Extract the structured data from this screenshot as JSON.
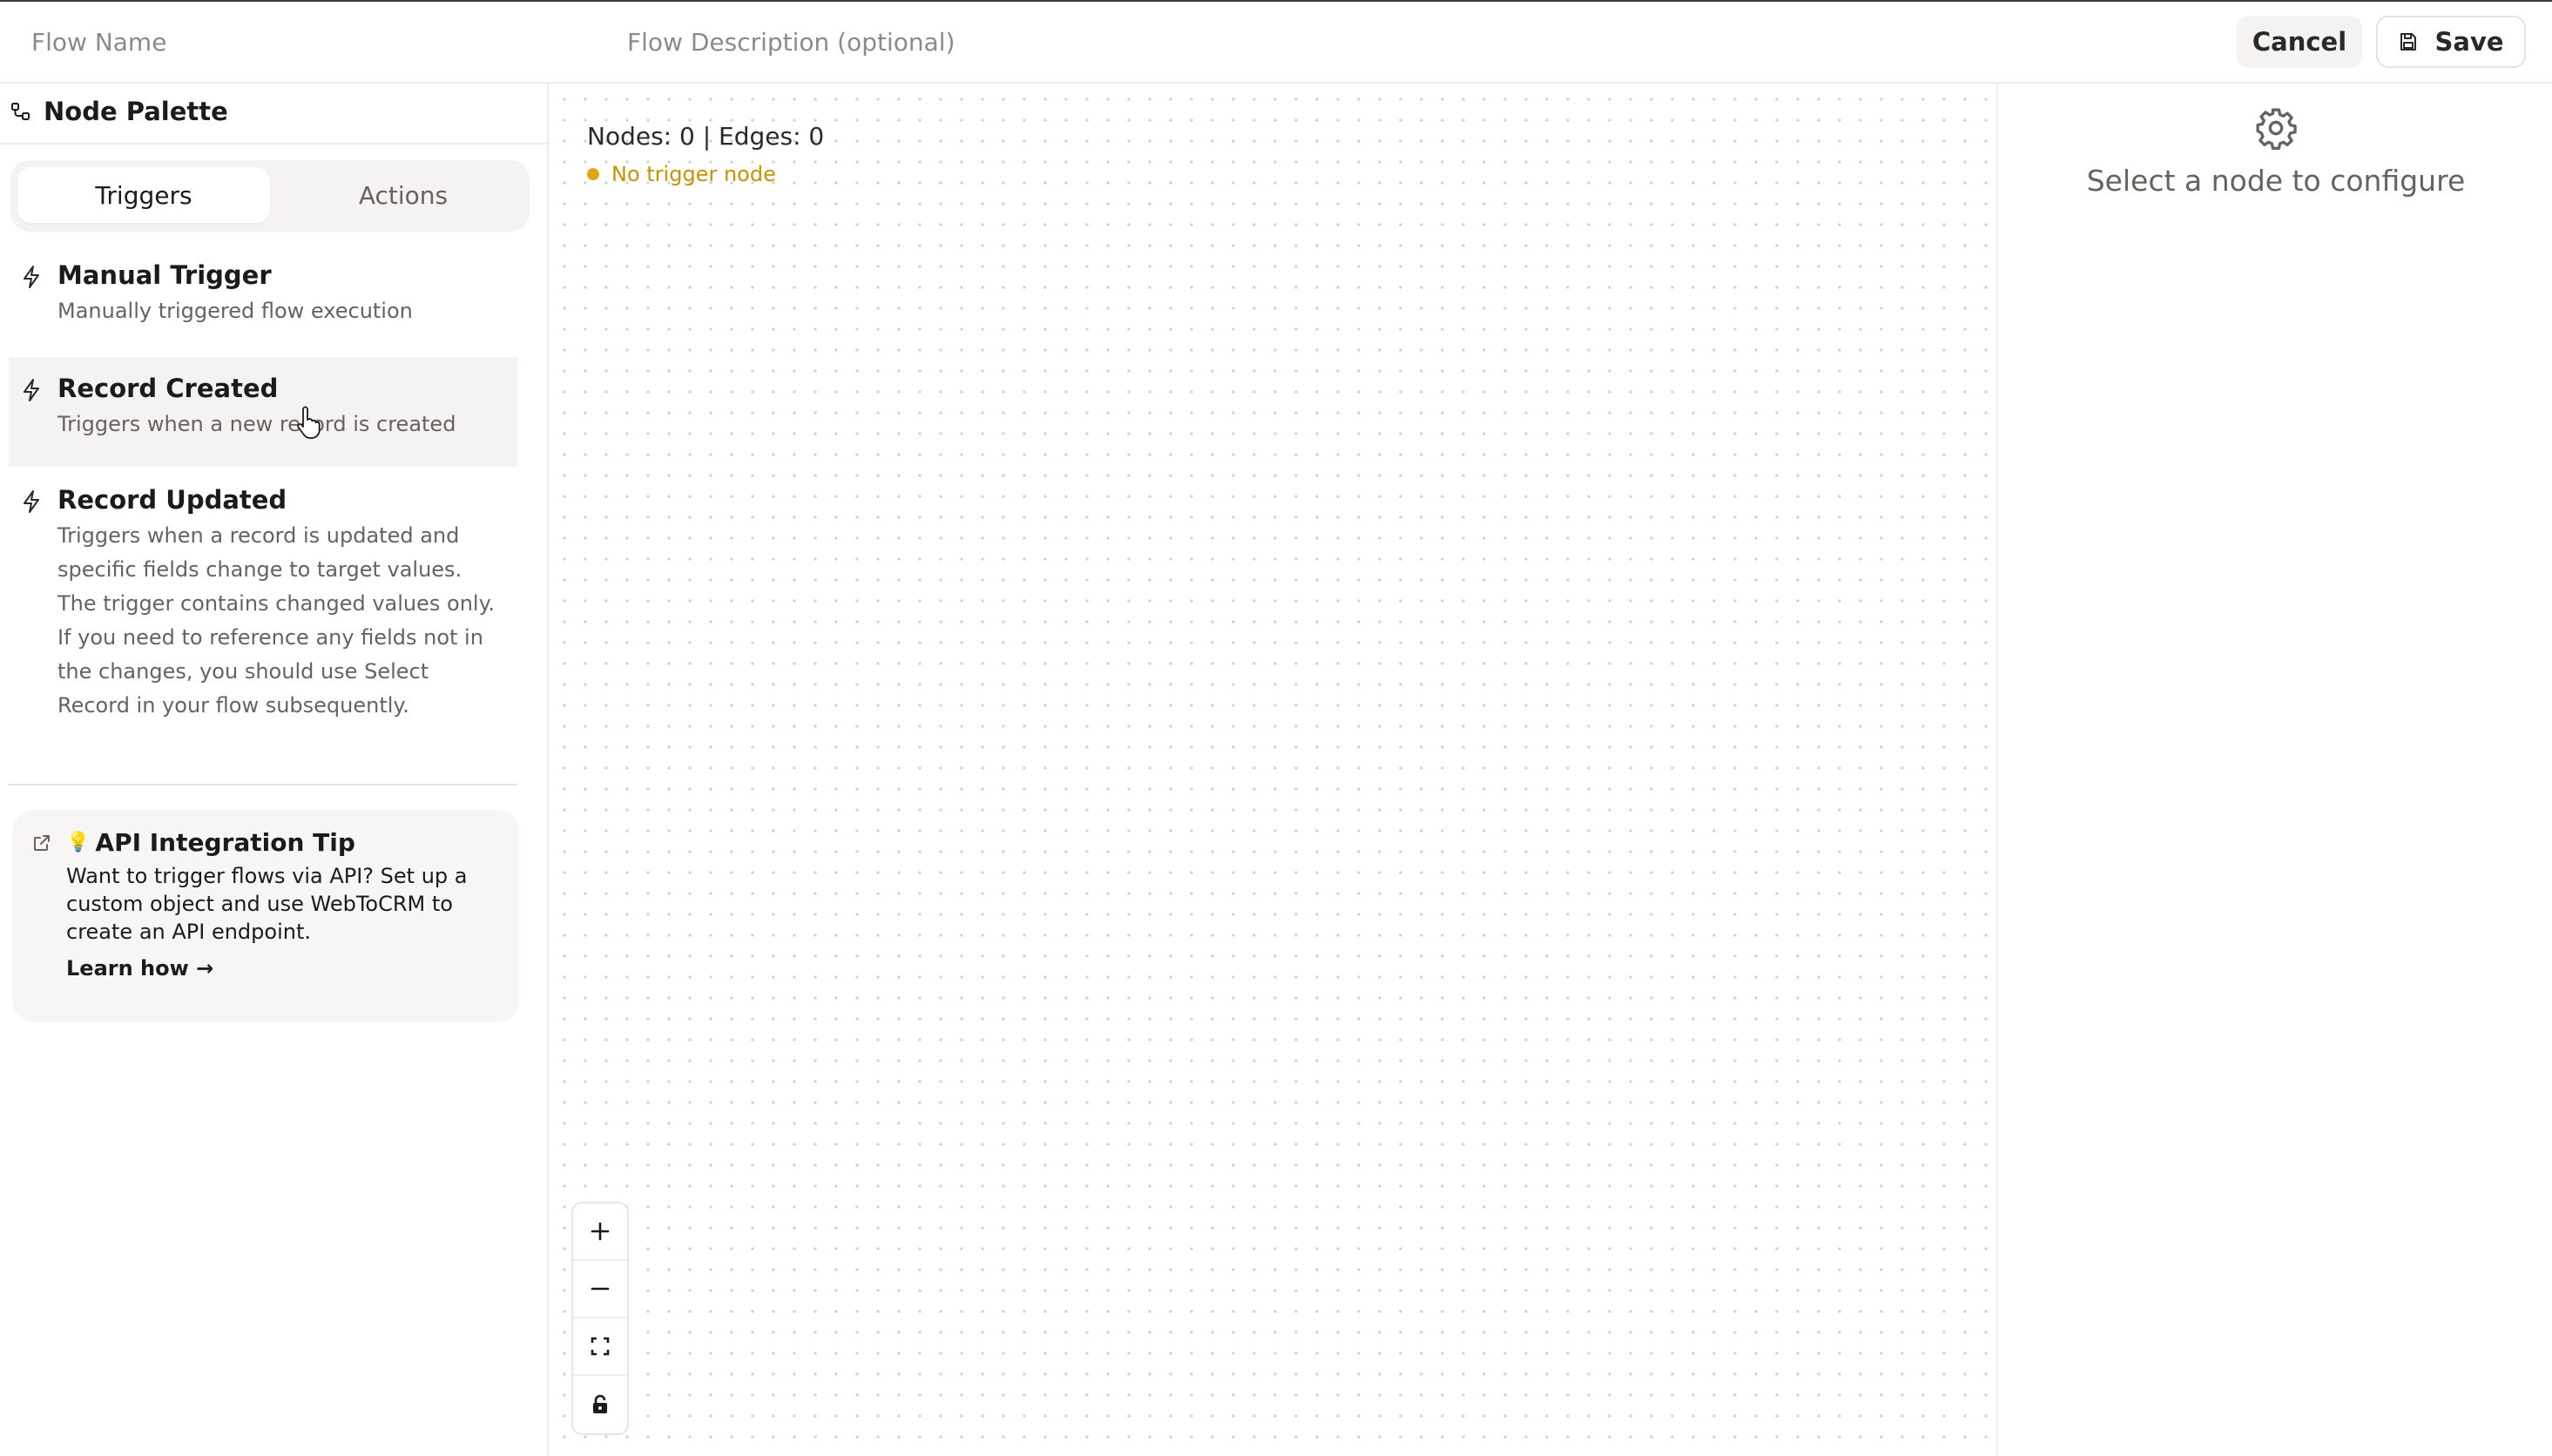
{
  "header": {
    "flow_name_placeholder": "Flow Name",
    "flow_description_placeholder": "Flow Description (optional)",
    "cancel_label": "Cancel",
    "save_label": "Save"
  },
  "palette": {
    "title": "Node Palette",
    "tabs": [
      {
        "label": "Triggers",
        "active": true
      },
      {
        "label": "Actions",
        "active": false
      }
    ],
    "items": [
      {
        "title": "Manual Trigger",
        "description": "Manually triggered flow execution",
        "icon": "bolt-icon"
      },
      {
        "title": "Record Created",
        "description": "Triggers when a new record is created",
        "icon": "bolt-icon"
      },
      {
        "title": "Record Updated",
        "description": "Triggers when a record is updated and specific fields change to target values. The trigger contains changed values only. If you need to reference any fields not in the changes, you should use Select Record in your flow subsequently.",
        "icon": "bolt-icon"
      }
    ],
    "tip": {
      "emoji": "💡",
      "title": "API Integration Tip",
      "body": "Want to trigger flows via API? Set up a custom object and use WebToCRM to create an API endpoint.",
      "link": "Learn how →"
    }
  },
  "canvas": {
    "stats": "Nodes: 0 | Edges: 0",
    "warning": "No trigger node",
    "controls": [
      "zoom-in-icon",
      "zoom-out-icon",
      "fit-view-icon",
      "lock-icon"
    ]
  },
  "config_panel": {
    "message": "Select a node to configure",
    "icon": "gear-icon"
  },
  "colors": {
    "warning": "#e0a80c",
    "muted_text": "#66635e",
    "panel_bg": "#f4f3f1"
  }
}
